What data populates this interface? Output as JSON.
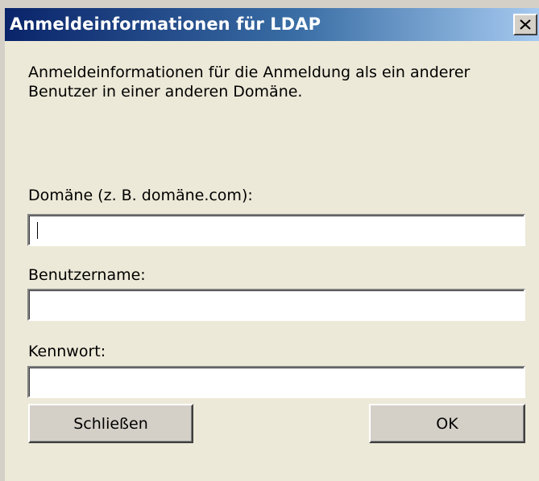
{
  "window": {
    "title": "Anmeldeinformationen für LDAP"
  },
  "dialog": {
    "description": "Anmeldeinformationen für die Anmeldung als ein anderer Benutzer in einer anderen Domäne.",
    "fields": [
      {
        "label": "Domäne (z. B. domäne.com):",
        "value": ""
      },
      {
        "label": "Benutzername:",
        "value": ""
      },
      {
        "label": "Kennwort:",
        "value": ""
      }
    ],
    "buttons": {
      "close_label": "Schließen",
      "ok_label": "OK"
    }
  },
  "icons": {
    "title_close": "close-icon"
  },
  "colors": {
    "titlebar_start": "#0a246a",
    "titlebar_end": "#a6caf0",
    "dialog_bg": "#ece9d8",
    "button_face": "#d4d0c8"
  }
}
